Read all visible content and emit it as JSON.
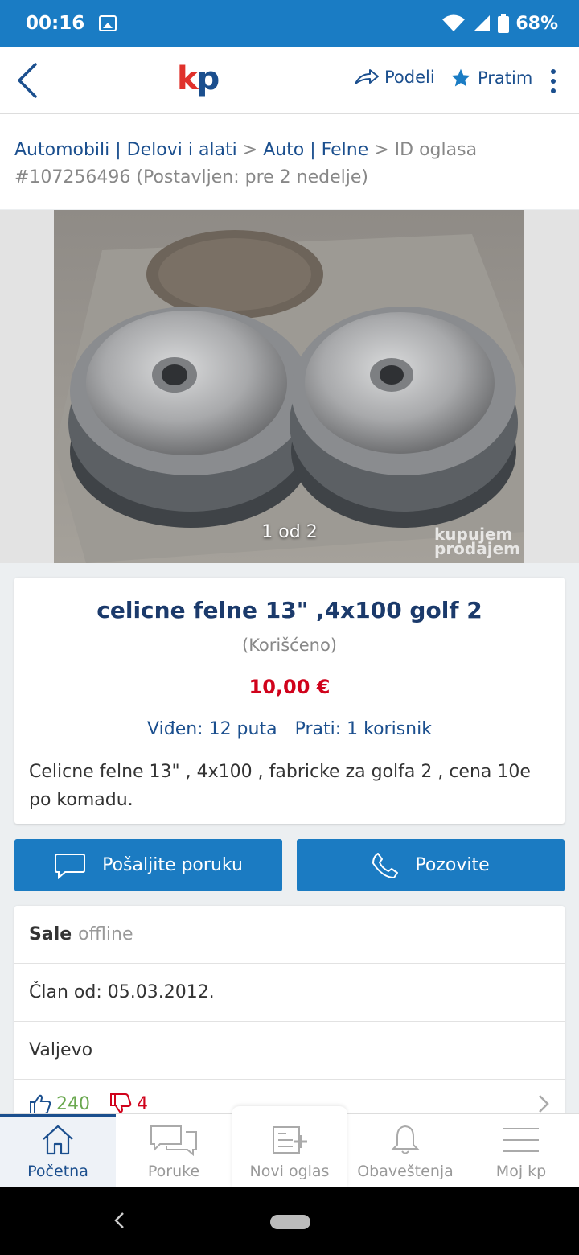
{
  "status_bar": {
    "time": "00:16",
    "battery": "68%",
    "icons": [
      "image-icon",
      "wifi-icon",
      "signal-icon",
      "battery-icon"
    ]
  },
  "app_bar": {
    "logo_k": "k",
    "logo_p": "p",
    "share_label": "Podeli",
    "follow_label": "Pratim",
    "accent_color": "#1b4f8e",
    "logo_red": "#e0312b"
  },
  "breadcrumb": {
    "cat1": "Automobili | Delovi i alati",
    "sep1": " > ",
    "cat2": "Auto | Felne",
    "sep2": " > ",
    "id_text": "ID oglasa #107256496 (Postavljen: pre 2 nedelje)"
  },
  "gallery": {
    "counter": "1 od 2",
    "watermark_line1": "kupujem",
    "watermark_line2": "prodajem"
  },
  "listing": {
    "title": "celicne felne 13\" ,4x100 golf 2",
    "condition": "(Korišćeno)",
    "price": "10,00 €",
    "views": "Viđen: 12 puta",
    "followers": "Prati: 1 korisnik",
    "description": "Celicne felne 13\" , 4x100 , fabricke za golfa 2 , cena 10e po komadu.",
    "price_color": "#d0021b"
  },
  "actions": {
    "message_label": "Pošaljite poruku",
    "call_label": "Pozovite",
    "button_color": "#1b7bc2"
  },
  "seller": {
    "name": "Sale",
    "status": "offline",
    "member_since": "Član od: 05.03.2012.",
    "location": "Valjevo",
    "positive": "240",
    "negative": "4"
  },
  "bottom_nav": {
    "home": "Početna",
    "messages": "Poruke",
    "new_ad": "Novi oglas",
    "notifications": "Obaveštenja",
    "my_kp": "Moj kp"
  }
}
